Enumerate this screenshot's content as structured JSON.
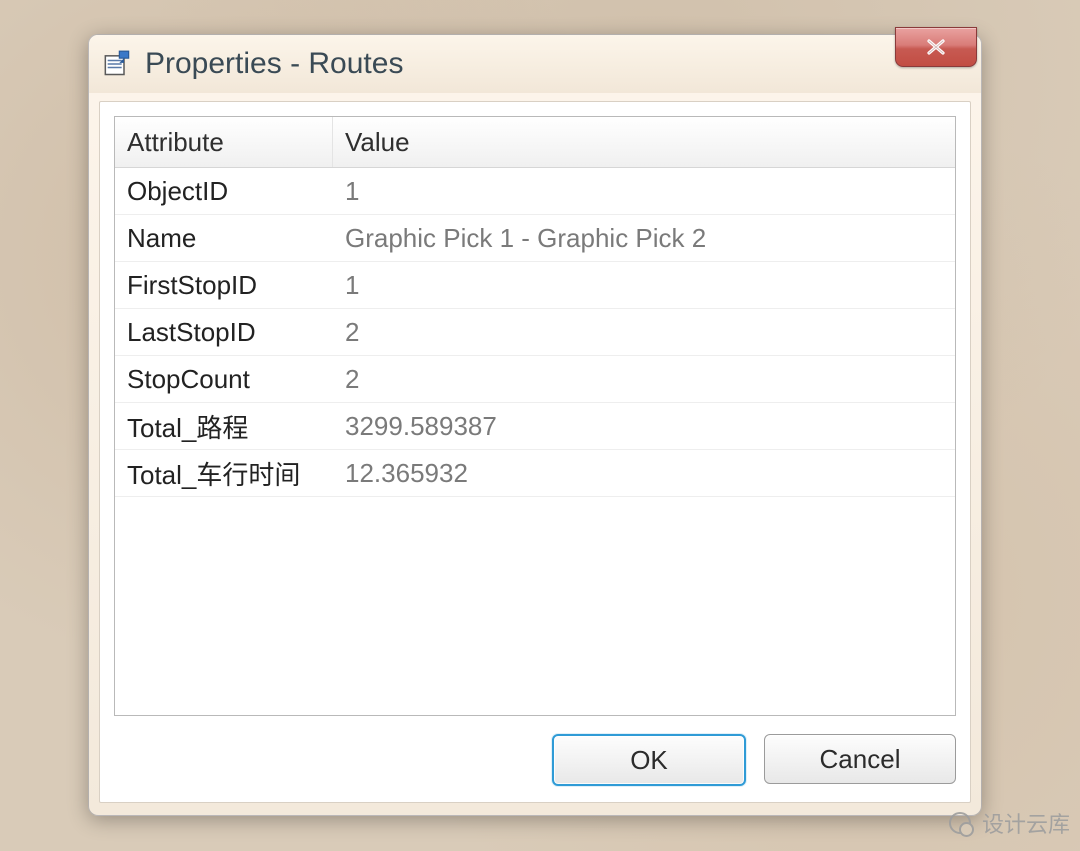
{
  "window": {
    "title": "Properties - Routes",
    "icon": "properties-icon"
  },
  "table": {
    "headers": {
      "attribute": "Attribute",
      "value": "Value"
    },
    "rows": [
      {
        "attr": "ObjectID",
        "value": "1"
      },
      {
        "attr": "Name",
        "value": "Graphic Pick 1 - Graphic Pick 2"
      },
      {
        "attr": "FirstStopID",
        "value": "1"
      },
      {
        "attr": "LastStopID",
        "value": "2"
      },
      {
        "attr": "StopCount",
        "value": "2"
      },
      {
        "attr": "Total_路程",
        "value": "3299.589387"
      },
      {
        "attr": "Total_车行时间",
        "value": "12.365932"
      }
    ]
  },
  "buttons": {
    "ok": "OK",
    "cancel": "Cancel"
  },
  "watermark": {
    "text": "设计云库"
  }
}
